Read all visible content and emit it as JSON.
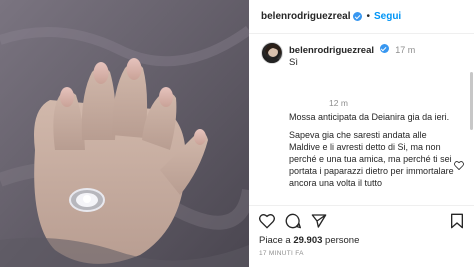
{
  "header": {
    "username": "belenrodriguezreal",
    "separator": "•",
    "follow_label": "Segui"
  },
  "caption": {
    "username": "belenrodriguezreal",
    "time": "17 m",
    "text": "Sì"
  },
  "reply": {
    "time": "12 m",
    "paragraph1": "Mossa anticipata da Deianira gia da ieri.",
    "paragraph2": "Sapeva gia che saresti andata alle Maldive e li avresti detto di Si, ma non perché e una tua amica, ma perché ti sei portata i paparazzi dietro per immortalare ancora una volta il tutto"
  },
  "footer": {
    "likes_prefix": "Piace a",
    "likes_count": "29.903",
    "likes_suffix": "persone",
    "time_ago": "17 MINUTI FA"
  },
  "icons": [
    "verified-icon",
    "heart-icon",
    "comment-icon",
    "share-icon",
    "bookmark-icon"
  ],
  "colors": {
    "accent": "#0095f6",
    "verified": "#3897f0",
    "muted": "#8e8e8e",
    "text": "#262626"
  }
}
